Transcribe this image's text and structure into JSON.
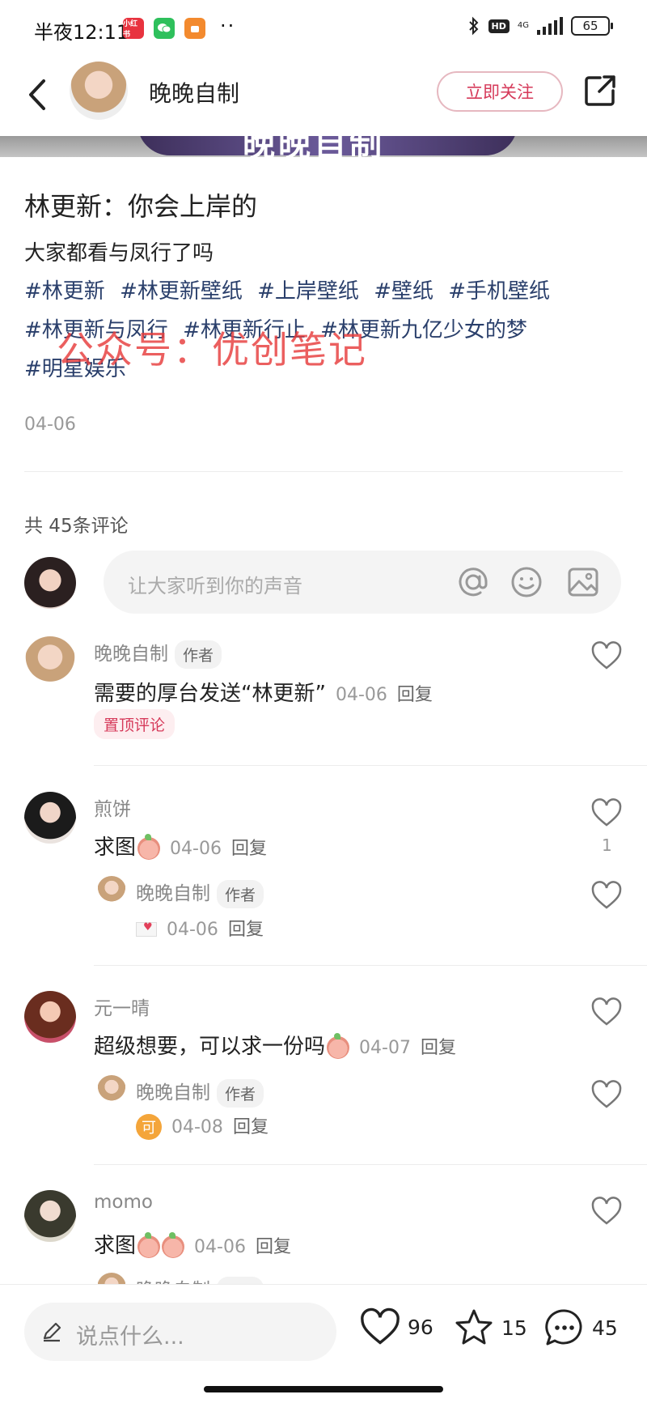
{
  "status_bar": {
    "time": "半夜12:11",
    "apps": [
      {
        "label": "小红书",
        "color": "#e8333f"
      },
      {
        "label": "微信",
        "color": "#2ec05c"
      },
      {
        "label": "淘宝",
        "color": "#f38a2e"
      }
    ],
    "more": "··",
    "hd": "HD",
    "network": "4G",
    "battery": "65"
  },
  "header": {
    "author_name": "晚晚自制",
    "follow_label": "立即关注"
  },
  "image_strip_text": "晚晚自制",
  "post": {
    "title": "林更新：你会上岸的",
    "body": "大家都看与凤行了吗",
    "tags": [
      "#林更新",
      "#林更新壁纸",
      "#上岸壁纸",
      "#壁纸",
      "#手机壁纸",
      "#林更新与凤行",
      "#林更新行止",
      "#林更新九亿少女的梦",
      "#明星娱乐"
    ],
    "watermark": "公众号：优创笔记",
    "date": "04-06"
  },
  "comments_section": {
    "count_label": "共 45条评论",
    "input_placeholder": "让大家听到你的声音"
  },
  "comments": [
    {
      "name": "晚晚自制",
      "author_tag": "作者",
      "text": "需要的厚台发送“林更新”",
      "date": "04-06",
      "reply": "回复",
      "pinned_label": "置顶评论"
    },
    {
      "name": "煎饼",
      "text": "求图",
      "date": "04-06",
      "reply": "回复",
      "likes": "1",
      "sub_reply": {
        "name": "晚晚自制",
        "author_tag": "作者",
        "date": "04-06",
        "reply": "回复"
      }
    },
    {
      "name": "元一晴",
      "text": "超级想要，可以求一份吗",
      "date": "04-07",
      "reply": "回复",
      "sub_reply": {
        "name": "晚晚自制",
        "author_tag": "作者",
        "emoji": "可",
        "date": "04-08",
        "reply": "回复"
      }
    },
    {
      "name": "momo",
      "text": "求图",
      "date": "04-06",
      "reply": "回复",
      "sub_reply": {
        "name": "晚晚自制",
        "author_tag": "作者"
      }
    }
  ],
  "bottom_bar": {
    "placeholder": "说点什么...",
    "likes": "96",
    "favorites": "15",
    "comments": "45"
  }
}
